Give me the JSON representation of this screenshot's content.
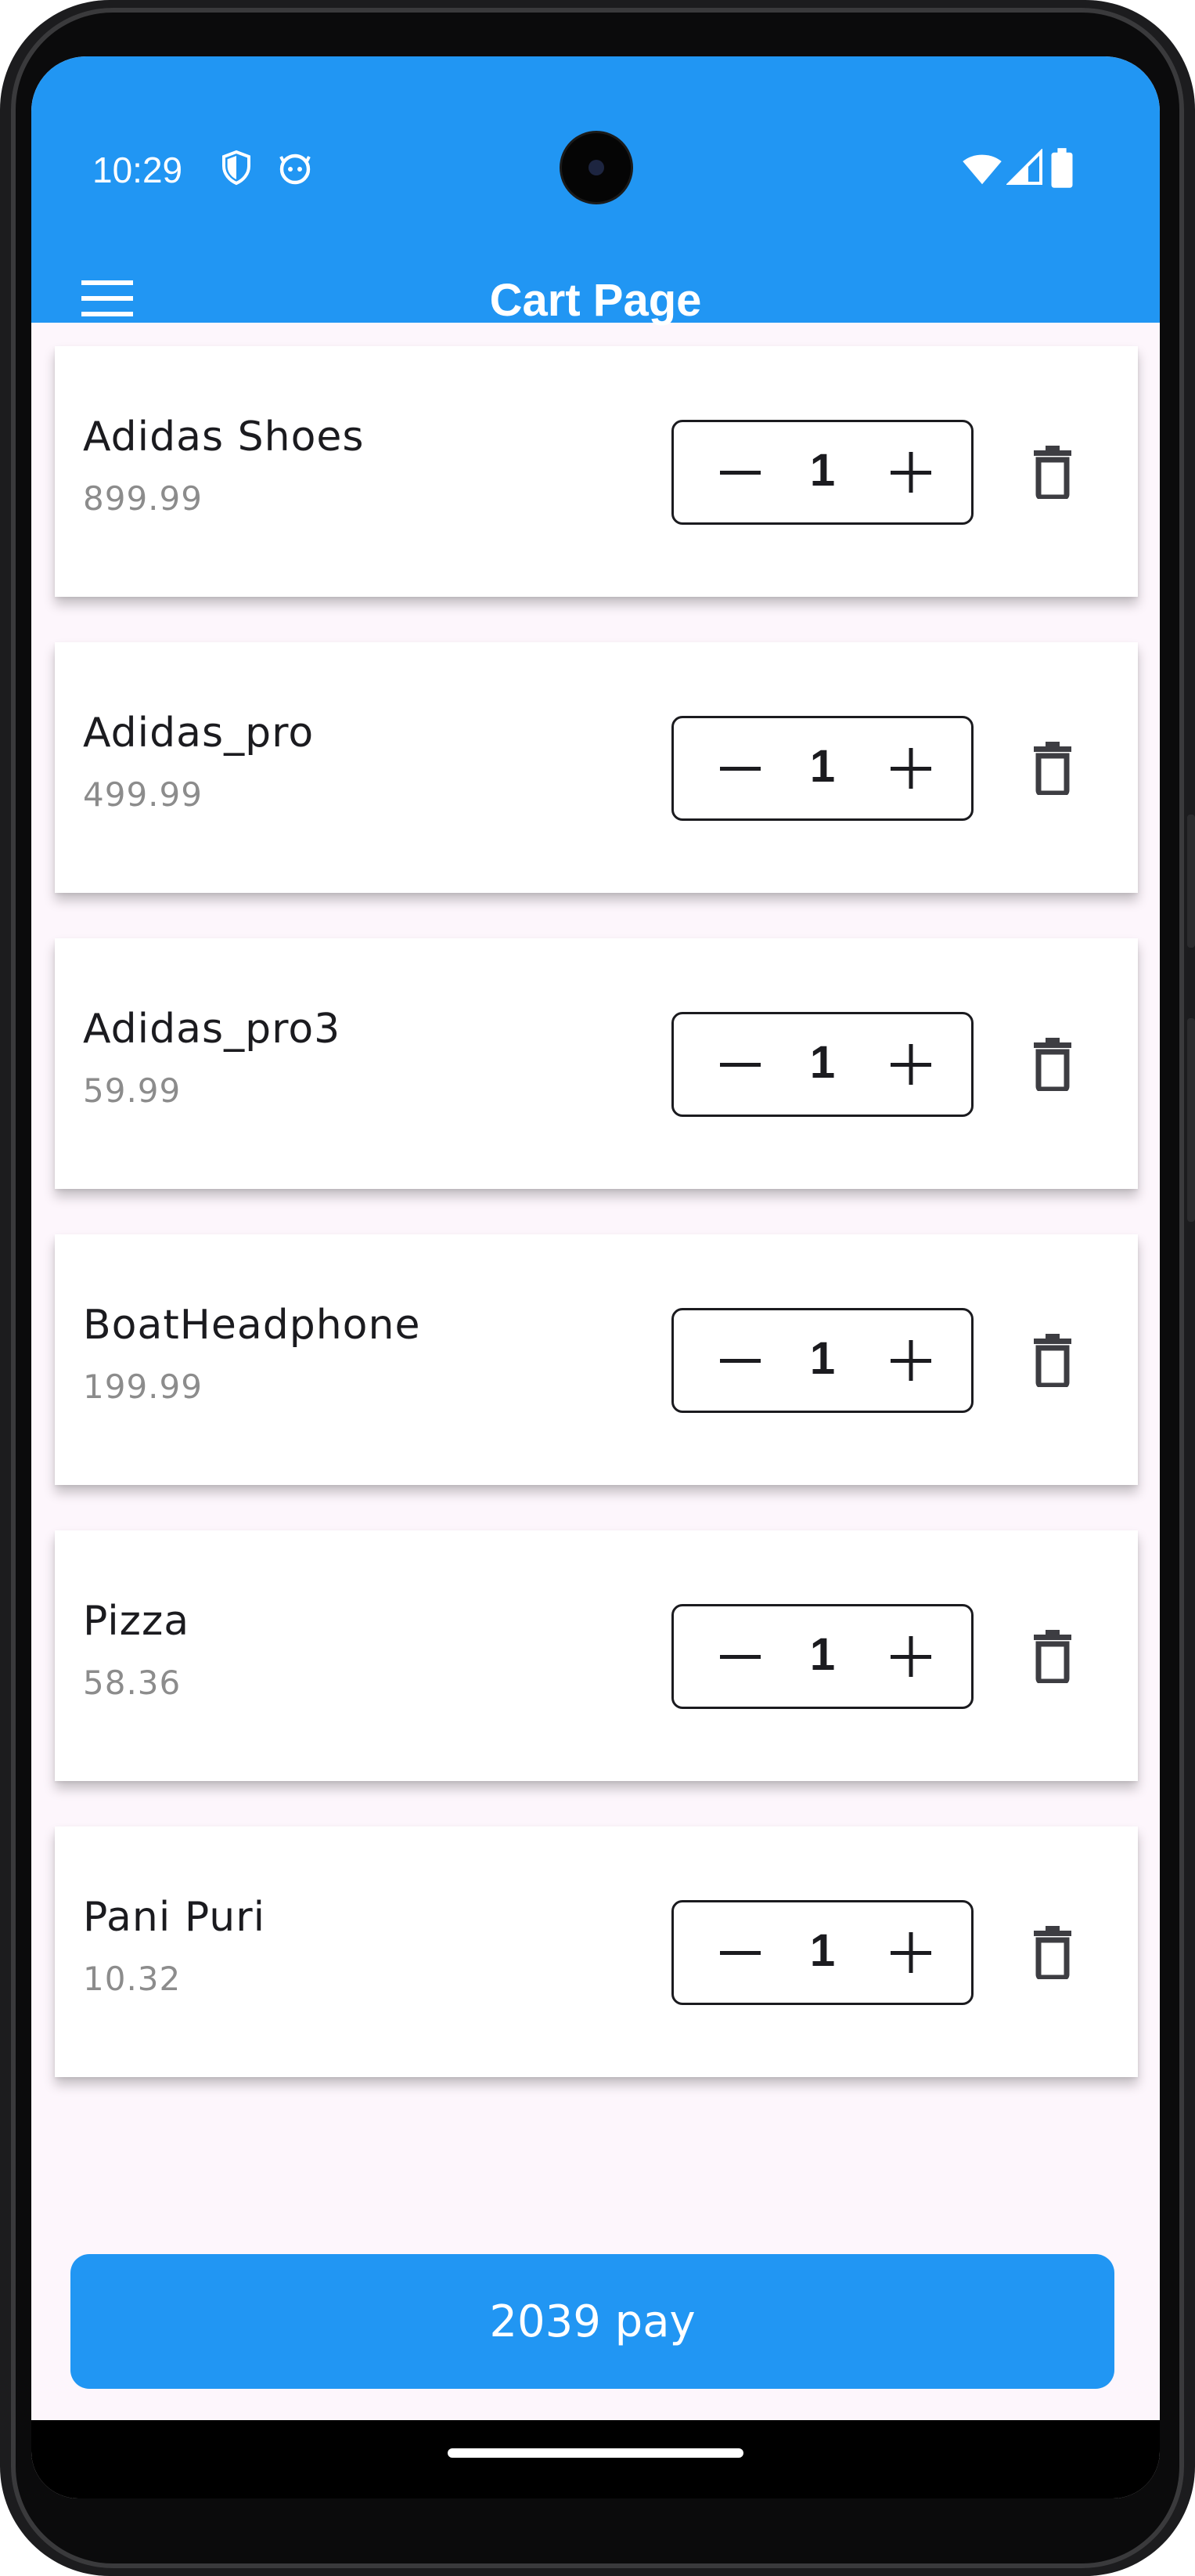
{
  "status_bar": {
    "time": "10:29",
    "icons": [
      "shield-icon",
      "android-face-icon",
      "wifi-icon",
      "cell-signal-icon",
      "battery-icon"
    ]
  },
  "app_bar": {
    "title": "Cart Page",
    "menu_icon": "hamburger-menu-icon",
    "color": "#2196f3"
  },
  "cart": {
    "items": [
      {
        "name": "Adidas Shoes",
        "price": "899.99",
        "quantity": "1"
      },
      {
        "name": "Adidas_pro",
        "price": "499.99",
        "quantity": "1"
      },
      {
        "name": "Adidas_pro3",
        "price": "59.99",
        "quantity": "1"
      },
      {
        "name": "BoatHeadphone",
        "price": "199.99",
        "quantity": "1"
      },
      {
        "name": "Pizza",
        "price": "58.36",
        "quantity": "1"
      },
      {
        "name": "Pani Puri",
        "price": "10.32",
        "quantity": "1"
      }
    ]
  },
  "pay_button": {
    "label": "2039 pay",
    "color": "#2196f3"
  }
}
